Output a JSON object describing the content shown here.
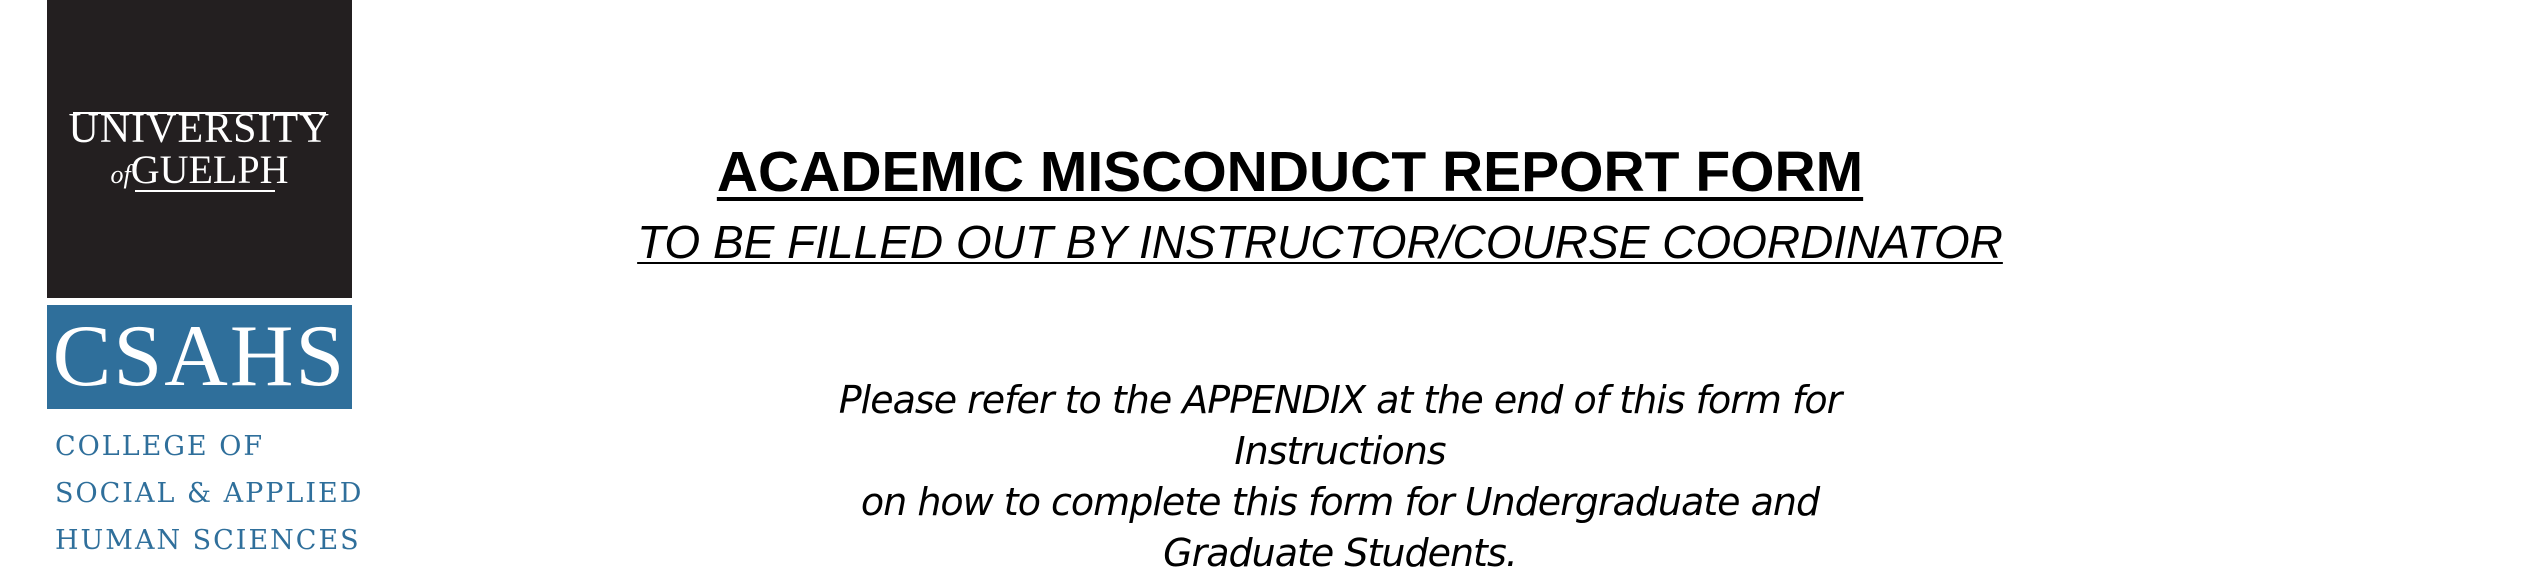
{
  "logo": {
    "university_line1": "UNIVERSITY",
    "university_of": "of",
    "university_line2": "GUELPH",
    "college_abbrev": "CSAHS",
    "college_name_lines": [
      "COLLEGE OF",
      "SOCIAL & APPLIED",
      "HUMAN SCIENCES"
    ],
    "colors": {
      "dark": "#231f20",
      "blue": "#2f6f9b"
    }
  },
  "header": {
    "title": "ACADEMIC MISCONDUCT REPORT FORM",
    "subtitle": "TO BE FILLED OUT BY INSTRUCTOR/COURSE COORDINATOR"
  },
  "instruction": {
    "lines": [
      "Please refer to the APPENDIX at the end of this form for Instructions",
      "on how to complete this form for Undergraduate and",
      "Graduate Students."
    ]
  }
}
